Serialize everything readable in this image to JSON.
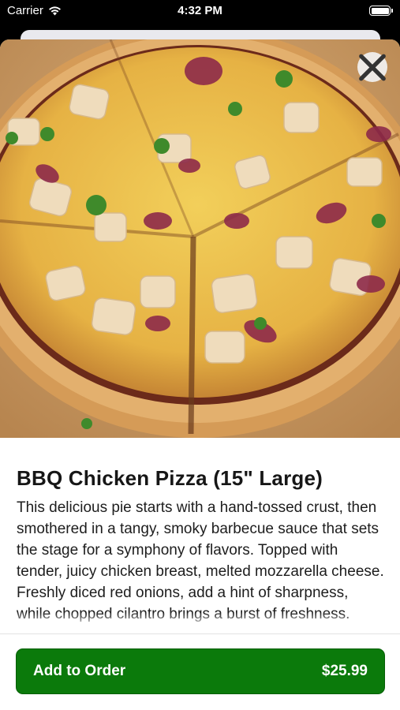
{
  "status_bar": {
    "carrier": "Carrier",
    "time": "4:32 PM"
  },
  "item": {
    "title": "BBQ Chicken Pizza (15\" Large)",
    "description": "This delicious pie starts with a hand-tossed crust, then smothered in a tangy, smoky barbecue sauce that sets the stage for a symphony of flavors. Topped with tender, juicy chicken breast, melted mozzarella cheese. Freshly diced red onions, add a hint of sharpness, while chopped cilantro brings a burst of freshness."
  },
  "icons": {
    "close": "close-icon",
    "wifi": "wifi-icon",
    "battery": "battery-icon"
  },
  "footer": {
    "add_label": "Add to Order",
    "price": "$25.99"
  },
  "colors": {
    "accent": "#0b7a0b",
    "sheet_background": "#ffffff",
    "status_bar_background": "#000000"
  }
}
